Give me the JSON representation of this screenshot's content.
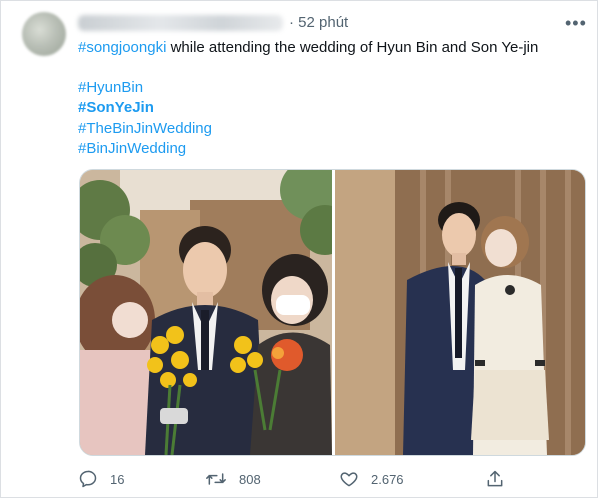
{
  "tweet": {
    "time": "· 52 phút",
    "more_label": "•••",
    "first_hashtag": "#songjoongki",
    "first_line_rest": " while attending the wedding of Hyun Bin and Son Ye-jin",
    "hashtags": [
      "#HyunBin",
      "#SonYeJin",
      "#TheBinJinWedding",
      "#BinJinWedding"
    ]
  },
  "actions": {
    "reply_count": "16",
    "retweet_count": "808",
    "like_count": "2.676"
  },
  "colors": {
    "link": "#1d9bf0",
    "text": "#0f1419",
    "muted": "#536471"
  },
  "icons": [
    "reply-icon",
    "retweet-icon",
    "like-icon",
    "share-icon",
    "more-icon"
  ]
}
